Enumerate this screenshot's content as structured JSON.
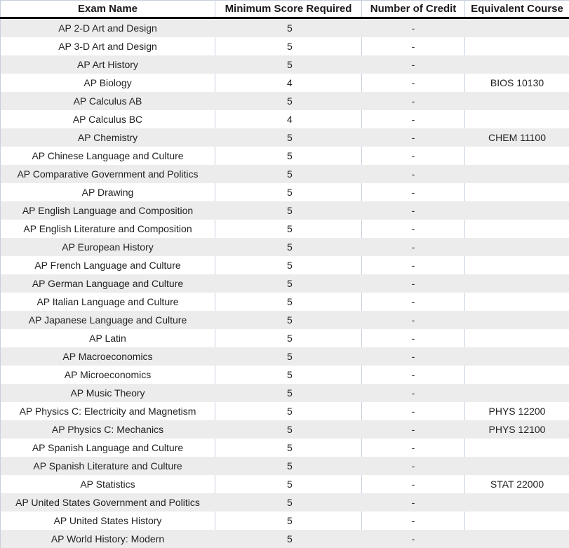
{
  "table": {
    "headers": [
      "Exam Name",
      "Minimum Score Required",
      "Number of Credit",
      "Equivalent Course"
    ],
    "rows": [
      {
        "exam": "AP 2-D Art and Design",
        "score": "5",
        "credit": "-",
        "course": ""
      },
      {
        "exam": "AP 3-D Art and Design",
        "score": "5",
        "credit": "-",
        "course": ""
      },
      {
        "exam": "AP Art History",
        "score": "5",
        "credit": "-",
        "course": ""
      },
      {
        "exam": "AP Biology",
        "score": "4",
        "credit": "-",
        "course": "BIOS 10130"
      },
      {
        "exam": "AP Calculus AB",
        "score": "5",
        "credit": "-",
        "course": ""
      },
      {
        "exam": "AP Calculus BC",
        "score": "4",
        "credit": "-",
        "course": ""
      },
      {
        "exam": "AP Chemistry",
        "score": "5",
        "credit": "-",
        "course": "CHEM 11100"
      },
      {
        "exam": "AP Chinese Language and Culture",
        "score": "5",
        "credit": "-",
        "course": ""
      },
      {
        "exam": "AP Comparative Government and Politics",
        "score": "5",
        "credit": "-",
        "course": ""
      },
      {
        "exam": "AP Drawing",
        "score": "5",
        "credit": "-",
        "course": ""
      },
      {
        "exam": "AP English Language and Composition",
        "score": "5",
        "credit": "-",
        "course": ""
      },
      {
        "exam": "AP English Literature and Composition",
        "score": "5",
        "credit": "-",
        "course": ""
      },
      {
        "exam": "AP European History",
        "score": "5",
        "credit": "-",
        "course": ""
      },
      {
        "exam": "AP French Language and Culture",
        "score": "5",
        "credit": "-",
        "course": ""
      },
      {
        "exam": "AP German Language and Culture",
        "score": "5",
        "credit": "-",
        "course": ""
      },
      {
        "exam": "AP Italian Language and Culture",
        "score": "5",
        "credit": "-",
        "course": ""
      },
      {
        "exam": "AP Japanese Language and Culture",
        "score": "5",
        "credit": "-",
        "course": ""
      },
      {
        "exam": "AP Latin",
        "score": "5",
        "credit": "-",
        "course": ""
      },
      {
        "exam": "AP Macroeconomics",
        "score": "5",
        "credit": "-",
        "course": ""
      },
      {
        "exam": "AP Microeconomics",
        "score": "5",
        "credit": "-",
        "course": ""
      },
      {
        "exam": "AP Music Theory",
        "score": "5",
        "credit": "-",
        "course": ""
      },
      {
        "exam": "AP Physics C: Electricity and Magnetism",
        "score": "5",
        "credit": "-",
        "course": "PHYS 12200"
      },
      {
        "exam": "AP Physics C: Mechanics",
        "score": "5",
        "credit": "-",
        "course": "PHYS 12100"
      },
      {
        "exam": "AP Spanish Language and Culture",
        "score": "5",
        "credit": "-",
        "course": ""
      },
      {
        "exam": "AP Spanish Literature and Culture",
        "score": "5",
        "credit": "-",
        "course": ""
      },
      {
        "exam": "AP Statistics",
        "score": "5",
        "credit": "-",
        "course": "STAT 22000"
      },
      {
        "exam": "AP United States Government and Politics",
        "score": "5",
        "credit": "-",
        "course": ""
      },
      {
        "exam": "AP United States History",
        "score": "5",
        "credit": "-",
        "course": ""
      },
      {
        "exam": "AP World History: Modern",
        "score": "5",
        "credit": "-",
        "course": ""
      }
    ]
  },
  "colors": {
    "shaded_row": "#ececec",
    "header_rule": "#000000",
    "grid_line": "#c8cfdc"
  }
}
